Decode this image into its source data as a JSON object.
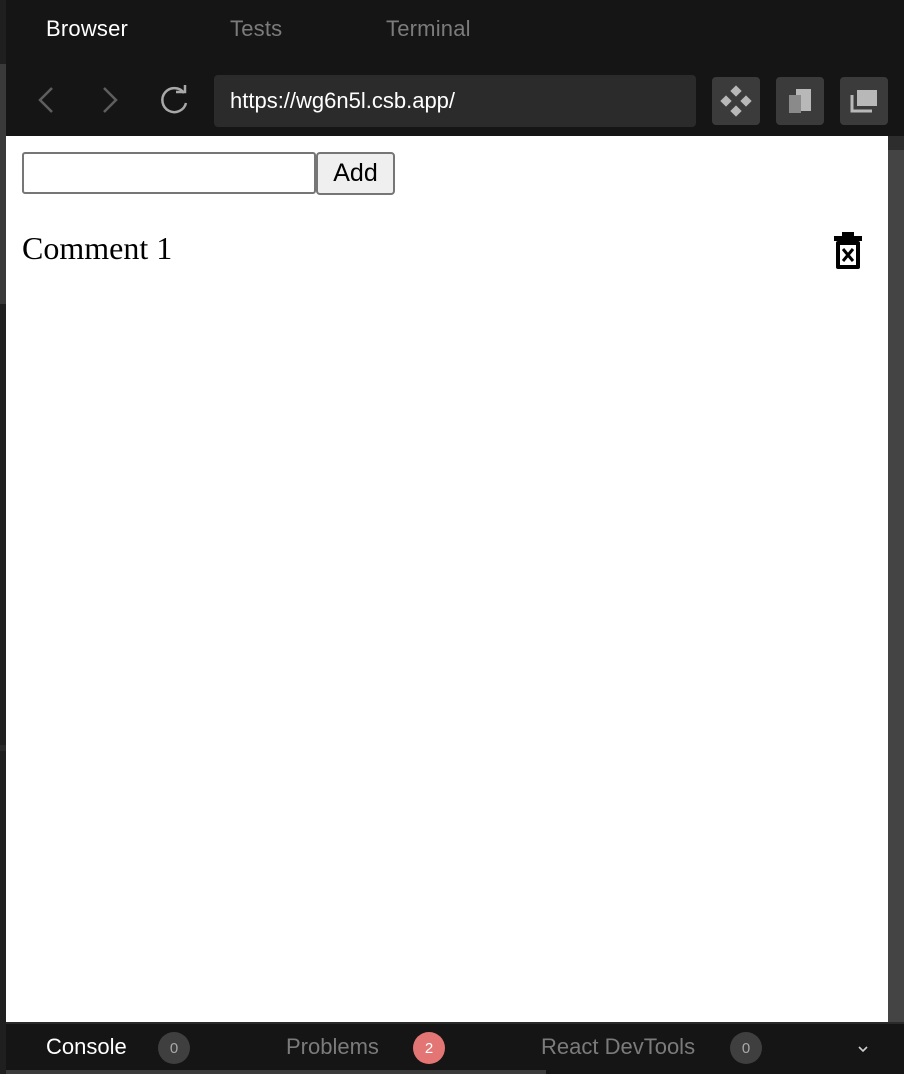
{
  "top_tabs": [
    {
      "label": "Browser",
      "active": true
    },
    {
      "label": "Tests",
      "active": false
    },
    {
      "label": "Terminal",
      "active": false
    }
  ],
  "navbar": {
    "back_icon": "chevron-left-icon",
    "forward_icon": "chevron-right-icon",
    "reload_icon": "reload-icon",
    "url": "https://wg6n5l.csb.app/",
    "tools": [
      "diamond-grid-icon",
      "copy-icon",
      "window-stack-icon"
    ]
  },
  "preview": {
    "input_value": "",
    "input_placeholder": "",
    "add_label": "Add",
    "comments": [
      {
        "text": "Comment 1",
        "delete_icon": "trash-x-icon"
      }
    ]
  },
  "bottom_panel": {
    "tabs": [
      {
        "label": "Console",
        "count": "0",
        "active": true
      },
      {
        "label": "Problems",
        "count": "2",
        "active": false
      },
      {
        "label": "React DevTools",
        "count": "0",
        "active": false
      }
    ],
    "collapse_icon": "chevron-down-icon"
  },
  "colors": {
    "chrome_bg": "#151515",
    "url_bg": "#2b2b2b",
    "tool_bg": "#3b3b3b",
    "error_badge": "#e37674"
  }
}
